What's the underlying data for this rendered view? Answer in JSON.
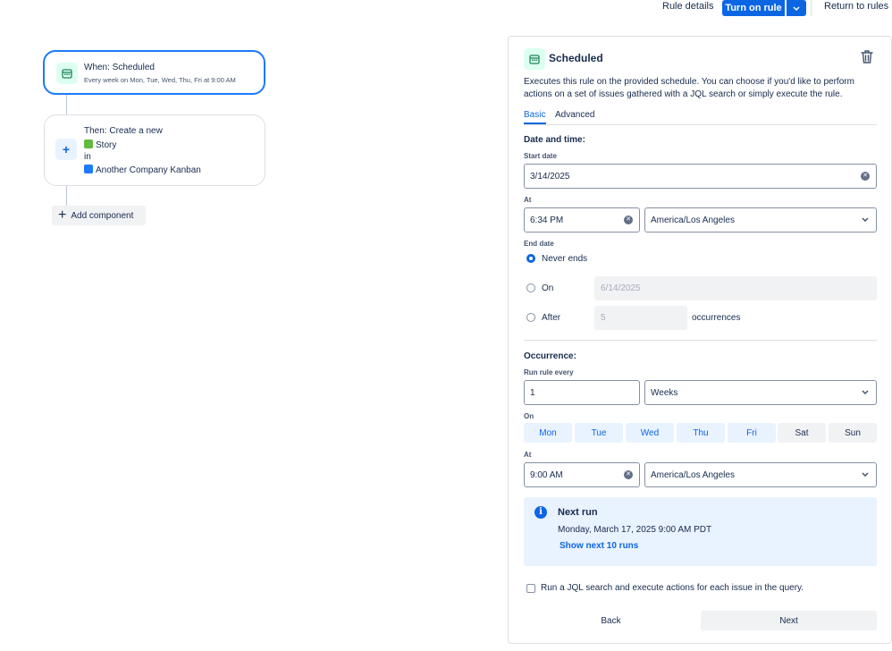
{
  "header": {
    "rule_details": "Rule details",
    "turn_on_rule": "Turn on rule",
    "return_to_rules": "Return to rules"
  },
  "canvas": {
    "trigger": {
      "title": "When: Scheduled",
      "subtitle": "Every week on Mon, Tue, Wed, Thu, Fri at 9:00 AM",
      "icon": "calendar-icon"
    },
    "action": {
      "title": "Then: Create a new",
      "issue_type": "Story",
      "in_label": "in",
      "project": "Another Company Kanban",
      "icon": "plus-icon"
    },
    "add_component": "Add component"
  },
  "panel": {
    "title": "Scheduled",
    "description": "Executes this rule on the provided schedule. You can choose if you'd like to perform actions on a set of issues gathered with a JQL search or simply execute the rule.",
    "tabs": [
      {
        "label": "Basic",
        "selected": true
      },
      {
        "label": "Advanced",
        "selected": false
      }
    ],
    "date_time": {
      "heading": "Date and time:",
      "start_date_label": "Start date",
      "start_date": "3/14/2025",
      "at_label": "At",
      "time": "6:34 PM",
      "timezone": "America/Los Angeles"
    },
    "end_date": {
      "label": "End date",
      "options": [
        {
          "label": "Never ends",
          "selected": true
        },
        {
          "label": "On",
          "selected": false
        },
        {
          "label": "After",
          "selected": false
        }
      ],
      "on_placeholder": "6/14/2025",
      "after_placeholder": "5",
      "occurrences_label": "occurrences"
    },
    "occurrence": {
      "heading": "Occurrence:",
      "run_every_label": "Run rule every",
      "run_every_value": "1",
      "unit": "Weeks",
      "on_label": "On",
      "days": [
        {
          "label": "Mon",
          "selected": true
        },
        {
          "label": "Tue",
          "selected": true
        },
        {
          "label": "Wed",
          "selected": true
        },
        {
          "label": "Thu",
          "selected": true
        },
        {
          "label": "Fri",
          "selected": true
        },
        {
          "label": "Sat",
          "selected": false
        },
        {
          "label": "Sun",
          "selected": false
        }
      ],
      "at_label": "At",
      "time": "9:00 AM",
      "timezone": "America/Los Angeles"
    },
    "next_run": {
      "title": "Next run",
      "value": "Monday, March 17, 2025 9:00 AM PDT",
      "link": "Show next 10 runs"
    },
    "jql_checkbox_label": "Run a JQL search and execute actions for each issue in the query.",
    "back_label": "Back",
    "next_label": "Next"
  },
  "colors": {
    "primary": "#0c66e4",
    "trigger_border": "#1d7afc",
    "info_bg": "#e9f2ff",
    "story_green": "#63ba3c"
  }
}
